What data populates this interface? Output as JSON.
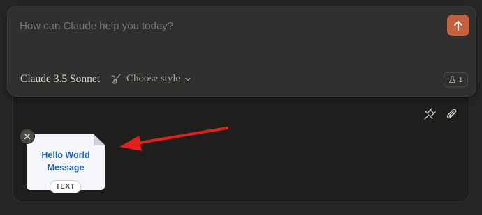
{
  "composer": {
    "placeholder": "How can Claude help you today?",
    "model_label": "Claude 3.5 Sonnet",
    "style_label": "Choose style",
    "flask_count": "1"
  },
  "attachment": {
    "preview_line1": "Hello World",
    "preview_line2": "Message",
    "type_badge": "TEXT"
  },
  "colors": {
    "accent": "#c6613f",
    "annotation_arrow": "#e3211c"
  },
  "icons": [
    "arrow-up-icon",
    "brush-icon",
    "chevron-down-icon",
    "flask-icon",
    "plug-icon",
    "paperclip-icon",
    "close-icon"
  ]
}
